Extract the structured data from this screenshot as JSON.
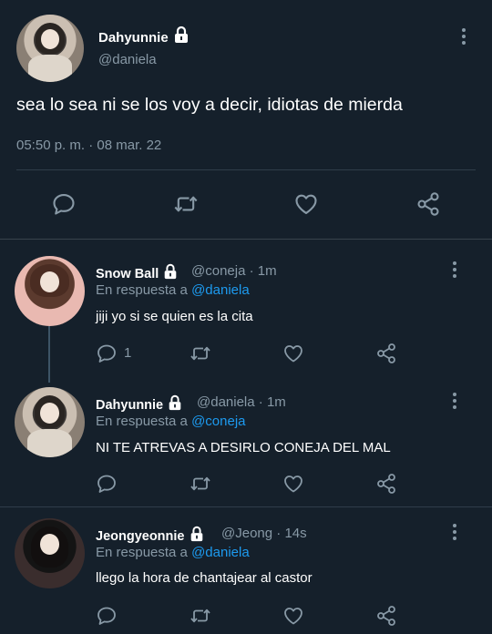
{
  "main_tweet": {
    "name": "Dahyunnie",
    "handle": "@daniela",
    "text": "sea lo sea ni se los voy a decir, idiotas de mierda",
    "time": "05:50 p. m.",
    "separator": "·",
    "date": "08 mar. 22"
  },
  "replies": [
    {
      "name": "Snow Ball",
      "handle": "@coneja",
      "sep": "·",
      "time": "1m",
      "reply_prefix": "En respuesta a",
      "reply_to": "@daniela",
      "text": "jiji yo si se quien es la cita",
      "reply_count": "1"
    },
    {
      "name": "Dahyunnie",
      "handle": "@daniela",
      "sep": "·",
      "time": "1m",
      "reply_prefix": "En respuesta a",
      "reply_to": "@coneja",
      "text": "NI TE ATREVAS A DESIRLO CONEJA DEL MAL",
      "reply_count": ""
    },
    {
      "name": "Jeongyeonnie",
      "handle": "@Jeong",
      "sep": "·",
      "time": "14s",
      "reply_prefix": "En respuesta a",
      "reply_to": "@daniela",
      "text": "llego la hora de chantajear al castor",
      "reply_count": ""
    }
  ],
  "icons": [
    "lock-icon",
    "more-icon",
    "reply-icon",
    "retweet-icon",
    "like-icon",
    "share-icon"
  ],
  "colors": {
    "background": "#15202b",
    "secondary_text": "#8899a6",
    "link": "#1d9bf0",
    "divider": "#2f3d4a"
  }
}
